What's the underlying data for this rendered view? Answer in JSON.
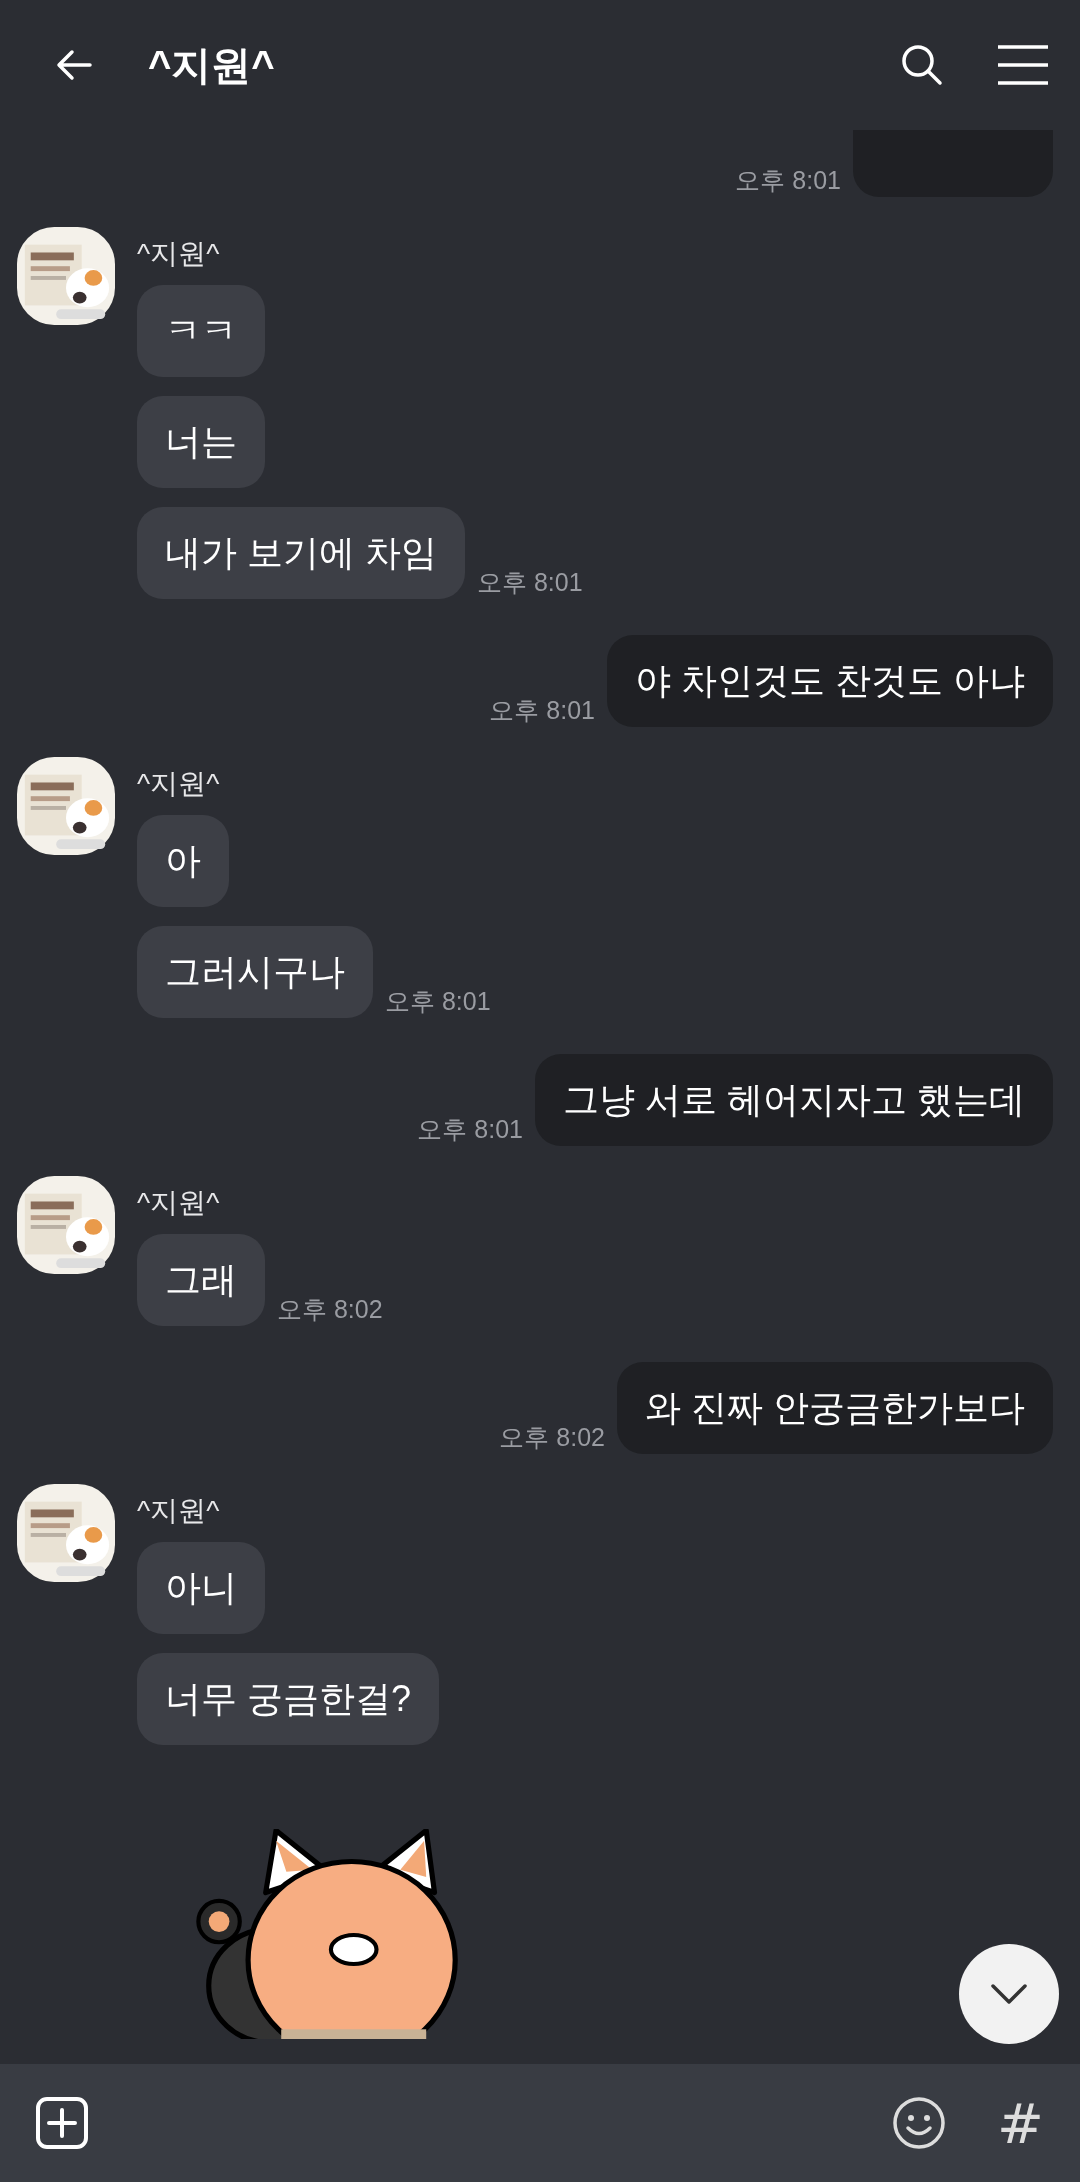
{
  "header": {
    "title": "^지원^"
  },
  "messages": [
    {
      "kind": "cut",
      "time": "오후 8:01"
    },
    {
      "kind": "incoming",
      "sender": "^지원^",
      "bubbles": [
        "ㅋㅋ",
        "너는",
        "내가 보기에 차임"
      ],
      "time": "오후 8:01"
    },
    {
      "kind": "outgoing",
      "text": "야 차인것도 찬것도 아냐",
      "time": "오후 8:01"
    },
    {
      "kind": "incoming",
      "sender": "^지원^",
      "bubbles": [
        "아",
        "그러시구나"
      ],
      "time": "오후 8:01"
    },
    {
      "kind": "outgoing",
      "text": "그냥 서로 헤어지자고 했는데",
      "time": "오후 8:01"
    },
    {
      "kind": "incoming",
      "sender": "^지원^",
      "bubbles": [
        "그래"
      ],
      "time": "오후 8:02"
    },
    {
      "kind": "outgoing",
      "text": "와 진짜 안궁금한가보다",
      "time": "오후 8:02"
    },
    {
      "kind": "incoming",
      "sender": "^지원^",
      "bubbles": [
        "아니",
        "너무 궁금한걸?"
      ]
    },
    {
      "kind": "sticker"
    }
  ],
  "input_bar": {
    "hash_label": "#"
  }
}
